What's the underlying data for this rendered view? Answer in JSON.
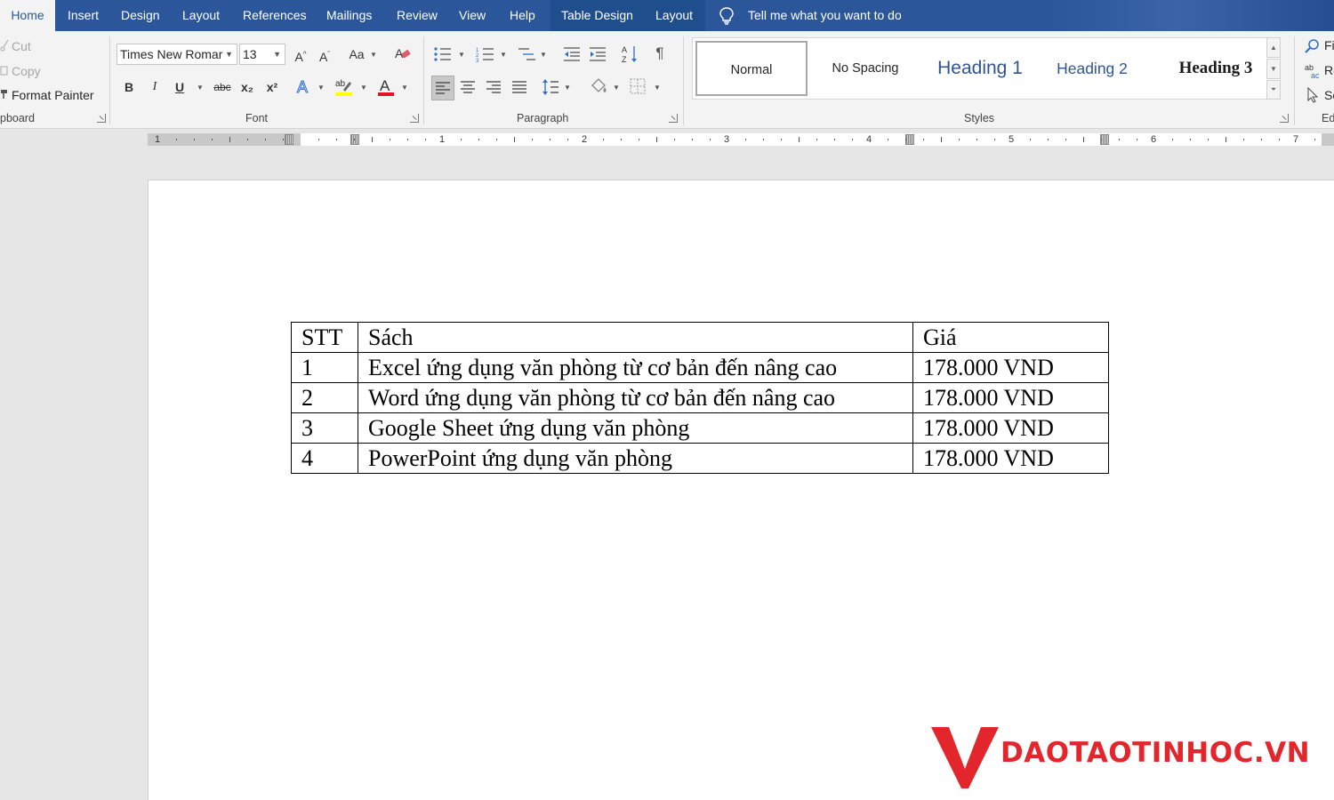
{
  "tabs": [
    {
      "label": "Home",
      "active": true
    },
    {
      "label": "Insert"
    },
    {
      "label": "Design"
    },
    {
      "label": "Layout"
    },
    {
      "label": "References"
    },
    {
      "label": "Mailings"
    },
    {
      "label": "Review"
    },
    {
      "label": "View"
    },
    {
      "label": "Help"
    },
    {
      "label": "Table Design",
      "contextual": true
    },
    {
      "label": "Layout",
      "contextual": true
    }
  ],
  "tell_me": "Tell me what you want to do",
  "clipboard": {
    "cut": "Cut",
    "copy": "Copy",
    "format_painter": "Format Painter",
    "group_label": "pboard"
  },
  "font": {
    "name": "Times New Romar",
    "size": "13",
    "change_case": "Aa",
    "bold": "B",
    "italic": "I",
    "underline": "U",
    "strikethrough": "abc",
    "subscript": "x₂",
    "superscript": "x²",
    "group_label": "Font",
    "highlight_color": "#ffff00",
    "font_color": "#e81123"
  },
  "paragraph": {
    "group_label": "Paragraph",
    "pilcrow": "¶"
  },
  "styles": {
    "items": [
      "Normal",
      "No Spacing",
      "Heading 1",
      "Heading 2",
      "Heading 3"
    ],
    "group_label": "Styles",
    "heading_color": "#2f5496"
  },
  "editing": {
    "find": "Fi",
    "replace": "Re",
    "select": "Se",
    "group_label": "Ed"
  },
  "ruler": {
    "numbers": [
      "1",
      "1",
      "2",
      "3",
      "4",
      "5",
      "6",
      "7"
    ]
  },
  "document": {
    "table": {
      "headers": [
        "STT",
        "Sách",
        "Giá"
      ],
      "rows": [
        [
          "1",
          "Excel ứng dụng văn phòng từ cơ bản đến nâng cao",
          "178.000 VND"
        ],
        [
          "2",
          "Word ứng dụng văn phòng từ cơ bản đến nâng cao",
          "178.000 VND"
        ],
        [
          "3",
          "Google Sheet ứng dụng văn phòng",
          "178.000 VND"
        ],
        [
          "4",
          "PowerPoint ứng dụng văn phòng",
          "178.000 VND"
        ]
      ]
    }
  },
  "watermark": {
    "text": "DAOTAOTINHOC.VN",
    "color": "#e3262b"
  },
  "theme": {
    "accent": "#2b579a",
    "ribbon_bg": "#f3f3f3"
  }
}
